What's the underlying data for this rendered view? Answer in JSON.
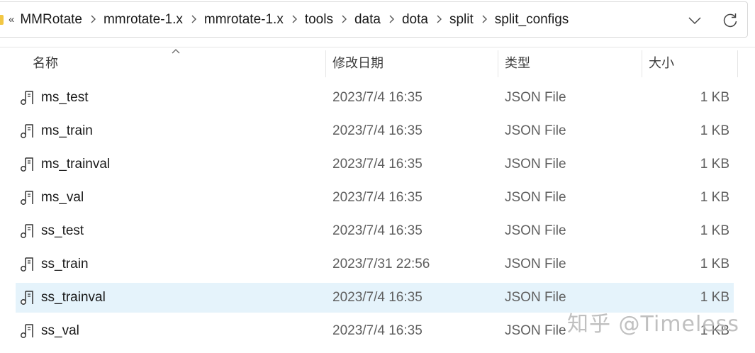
{
  "address_bar": {
    "overflow": "«",
    "crumbs": [
      "MMRotate",
      "mmrotate-1.x",
      "mmrotate-1.x",
      "tools",
      "data",
      "dota",
      "split",
      "split_configs"
    ]
  },
  "columns": {
    "name": "名称",
    "date": "修改日期",
    "type": "类型",
    "size": "大小"
  },
  "files": [
    {
      "name": "ms_test",
      "date": "2023/7/4 16:35",
      "type": "JSON File",
      "size": "1 KB"
    },
    {
      "name": "ms_train",
      "date": "2023/7/4 16:35",
      "type": "JSON File",
      "size": "1 KB"
    },
    {
      "name": "ms_trainval",
      "date": "2023/7/4 16:35",
      "type": "JSON File",
      "size": "1 KB"
    },
    {
      "name": "ms_val",
      "date": "2023/7/4 16:35",
      "type": "JSON File",
      "size": "1 KB"
    },
    {
      "name": "ss_test",
      "date": "2023/7/4 16:35",
      "type": "JSON File",
      "size": "1 KB"
    },
    {
      "name": "ss_train",
      "date": "2023/7/31 22:56",
      "type": "JSON File",
      "size": "1 KB"
    },
    {
      "name": "ss_trainval",
      "date": "2023/7/4 16:35",
      "type": "JSON File",
      "size": "1 KB",
      "selected": true
    },
    {
      "name": "ss_val",
      "date": "2023/7/4 16:35",
      "type": "JSON File",
      "size": "1 KB"
    }
  ],
  "icons": {
    "file": "json-file-icon",
    "dropdown": "chevron-down-icon",
    "refresh": "refresh-icon",
    "sort": "sort-ascending-icon"
  },
  "colors": {
    "selected_row": "#e5f3fb",
    "folder": "#f2c744"
  },
  "watermark": "知乎 @Timeless"
}
